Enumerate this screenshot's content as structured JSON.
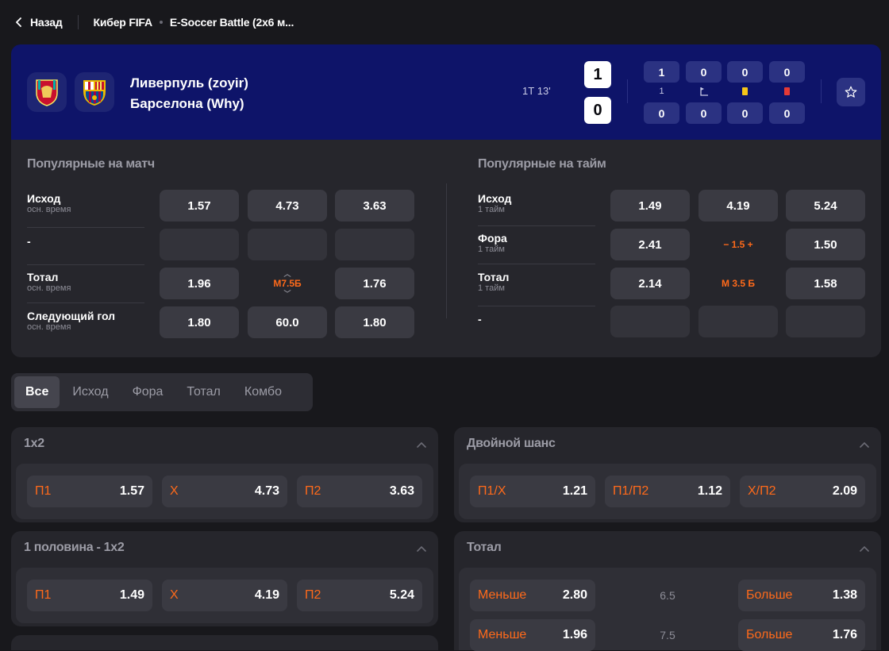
{
  "breadcrumbs": {
    "back_label": "Назад",
    "sport": "Кибер FIFA",
    "league": "E-Soccer Battle (2x6 м..."
  },
  "match": {
    "team1": "Ливерпуль (zoyir)",
    "team2": "Барселона (Why)",
    "time": "1Т 13'",
    "score1": "1",
    "score2": "0",
    "stats_row1": [
      "1",
      "0",
      "0",
      "0"
    ],
    "stats_row2": [
      "0",
      "0",
      "0",
      "0"
    ],
    "stats_icons": [
      "1",
      "corner-icon",
      "yellow-card-icon",
      "red-card-icon"
    ],
    "stat_icon_label": "1"
  },
  "popular_match": {
    "title": "Популярные на матч",
    "rows": [
      {
        "label": "Исход",
        "sub": "осн. время",
        "odds": [
          "1.57",
          "4.73",
          "3.63"
        ]
      },
      {
        "label": "-",
        "sub": "",
        "odds": [
          "",
          "",
          ""
        ]
      },
      {
        "label": "Тотал",
        "sub": "осн. время",
        "odds": [
          "1.96",
          "М7.5Б",
          "1.76"
        ]
      },
      {
        "label": "Следующий гол",
        "sub": "осн. время",
        "odds": [
          "1.80",
          "60.0",
          "1.80"
        ]
      }
    ]
  },
  "popular_half": {
    "title": "Популярные на тайм",
    "rows": [
      {
        "label": "Исход",
        "sub": "1 тайм",
        "odds": [
          "1.49",
          "4.19",
          "5.24"
        ]
      },
      {
        "label": "Фора",
        "sub": "1 тайм",
        "odds": [
          "2.41",
          "− 1.5 +",
          "1.50"
        ]
      },
      {
        "label": "Тотал",
        "sub": "1 тайм",
        "odds": [
          "2.14",
          "М 3.5 Б",
          "1.58"
        ]
      },
      {
        "label": "-",
        "sub": "",
        "odds": [
          "",
          "",
          ""
        ]
      }
    ]
  },
  "tabs": [
    "Все",
    "Исход",
    "Фора",
    "Тотал",
    "Комбо"
  ],
  "markets": {
    "m1x2": {
      "title": "1x2",
      "odds": [
        {
          "label": "П1",
          "value": "1.57"
        },
        {
          "label": "Х",
          "value": "4.73"
        },
        {
          "label": "П2",
          "value": "3.63"
        }
      ]
    },
    "double": {
      "title": "Двойной шанс",
      "odds": [
        {
          "label": "П1/Х",
          "value": "1.21"
        },
        {
          "label": "П1/П2",
          "value": "1.12"
        },
        {
          "label": "Х/П2",
          "value": "2.09"
        }
      ]
    },
    "half1x2": {
      "title": "1 половина - 1x2",
      "odds": [
        {
          "label": "П1",
          "value": "1.49"
        },
        {
          "label": "Х",
          "value": "4.19"
        },
        {
          "label": "П2",
          "value": "5.24"
        }
      ]
    },
    "total": {
      "title": "Тотал",
      "rows": [
        {
          "under_label": "Меньше",
          "under": "2.80",
          "param": "6.5",
          "over_label": "Больше",
          "over": "1.38"
        },
        {
          "under_label": "Меньше",
          "under": "1.96",
          "param": "7.5",
          "over_label": "Больше",
          "over": "1.76"
        }
      ]
    }
  },
  "colors": {
    "scoreboard_bg": "#0e1469",
    "accent": "#ff6a1a",
    "panel_bg": "#26262c",
    "odd_bg": "#3a3a42"
  }
}
